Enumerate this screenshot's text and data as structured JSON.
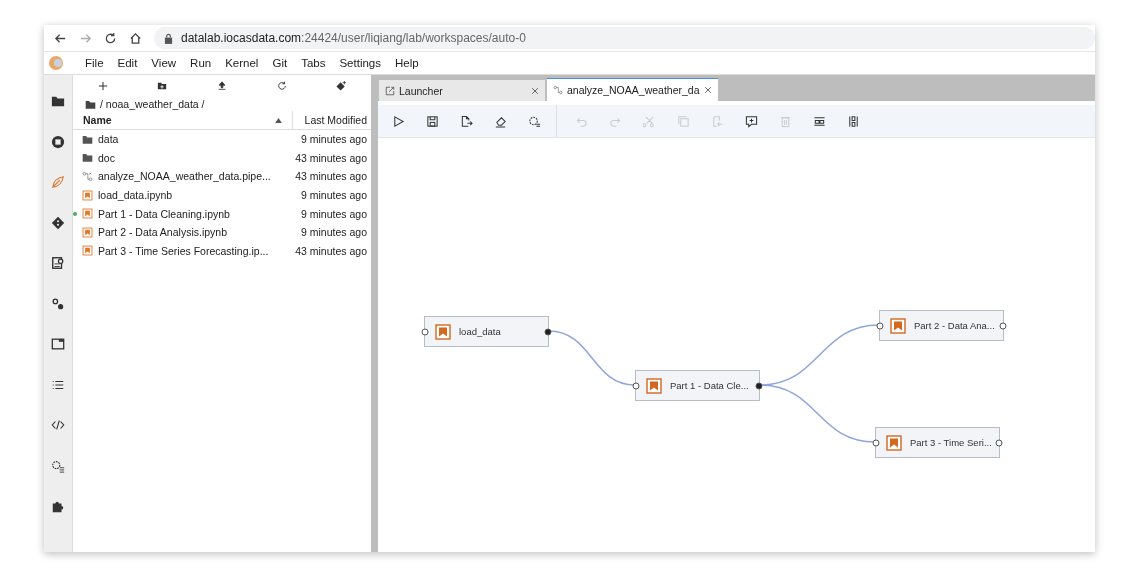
{
  "browser": {
    "url_host": "datalab.iocasdata.com",
    "url_path": ":24424/user/liqiang/lab/workspaces/auto-0"
  },
  "menu": [
    "File",
    "Edit",
    "View",
    "Run",
    "Kernel",
    "Git",
    "Tabs",
    "Settings",
    "Help"
  ],
  "activity_bar": [
    {
      "kind": "folder"
    },
    {
      "kind": "stop"
    },
    {
      "kind": "leaf"
    },
    {
      "kind": "git"
    },
    {
      "kind": "inspect"
    },
    {
      "kind": "gears"
    },
    {
      "kind": "window"
    },
    {
      "kind": "list"
    },
    {
      "kind": "code"
    },
    {
      "kind": "gearlist"
    },
    {
      "kind": "puzzle"
    }
  ],
  "file_browser": {
    "path": "/ noaa_weather_data /",
    "columns": [
      "Name",
      "Last Modified"
    ],
    "files": [
      {
        "kind": "folder",
        "name": "data",
        "modified": "9 minutes ago",
        "running": false
      },
      {
        "kind": "folder",
        "name": "doc",
        "modified": "43 minutes ago",
        "running": false
      },
      {
        "kind": "pipeline",
        "name": "analyze_NOAA_weather_data.pipe...",
        "modified": "43 minutes ago",
        "running": false
      },
      {
        "kind": "notebook",
        "name": "load_data.ipynb",
        "modified": "9 minutes ago",
        "running": false
      },
      {
        "kind": "notebook",
        "name": "Part 1 - Data Cleaning.ipynb",
        "modified": "9 minutes ago",
        "running": true
      },
      {
        "kind": "notebook",
        "name": "Part 2 - Data Analysis.ipynb",
        "modified": "9 minutes ago",
        "running": false
      },
      {
        "kind": "notebook",
        "name": "Part 3 - Time Series Forecasting.ip...",
        "modified": "43 minutes ago",
        "running": false
      }
    ]
  },
  "tabs": [
    {
      "kind": "launcher",
      "label": "Launcher",
      "selected": false
    },
    {
      "kind": "pipeline",
      "label": "analyze_NOAA_weather_da",
      "selected": true
    }
  ],
  "toolbar": [
    {
      "kind": "run",
      "disabled": false
    },
    {
      "kind": "save",
      "disabled": false
    },
    {
      "kind": "export",
      "disabled": false
    },
    {
      "kind": "clear",
      "disabled": false
    },
    {
      "kind": "runtimes",
      "disabled": false
    },
    {
      "kind": "undo",
      "disabled": true
    },
    {
      "kind": "redo",
      "disabled": true
    },
    {
      "kind": "cut",
      "disabled": true
    },
    {
      "kind": "copy",
      "disabled": true
    },
    {
      "kind": "paste",
      "disabled": true
    },
    {
      "kind": "comment",
      "disabled": false
    },
    {
      "kind": "delete",
      "disabled": true
    },
    {
      "kind": "arrange-h",
      "disabled": false
    },
    {
      "kind": "arrange-v",
      "disabled": false
    }
  ],
  "pipeline_nodes": [
    {
      "label": "load_data"
    },
    {
      "label": "Part 1 - Data Cle..."
    },
    {
      "label": "Part 2 - Data Ana..."
    },
    {
      "label": "Part 3 - Time Seri..."
    }
  ]
}
